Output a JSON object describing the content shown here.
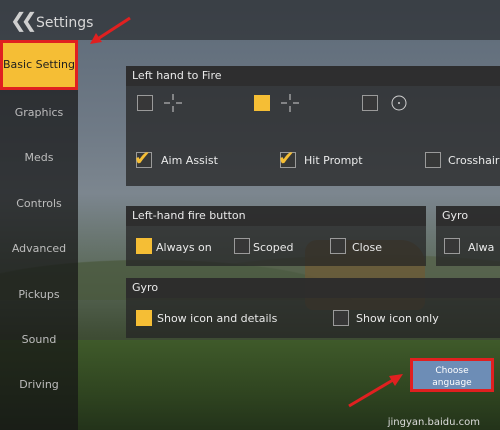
{
  "window": {
    "title": "Settings"
  },
  "sidebar": {
    "items": [
      {
        "label": "Basic Setting",
        "active": true
      },
      {
        "label": "Graphics"
      },
      {
        "label": "Meds"
      },
      {
        "label": "Controls"
      },
      {
        "label": "Advanced"
      },
      {
        "label": "Pickups"
      },
      {
        "label": "Sound"
      },
      {
        "label": "Driving"
      }
    ]
  },
  "left_hand_fire": {
    "title": "Left hand to Fire",
    "options": [
      {
        "checked": false,
        "icon": "crosshair-plus-icon"
      },
      {
        "checked": true,
        "icon": "crosshair-plus-icon"
      },
      {
        "checked": false,
        "icon": "crosshair-circle-icon"
      }
    ],
    "toggles": [
      {
        "label": "Aim Assist",
        "checked": true
      },
      {
        "label": "Hit Prompt",
        "checked": true
      },
      {
        "label": "Crosshair",
        "checked": false
      }
    ]
  },
  "left_hand_fire_button": {
    "title": "Left-hand fire button",
    "options": [
      {
        "label": "Always on",
        "checked": true
      },
      {
        "label": "Scoped",
        "checked": false
      },
      {
        "label": "Close",
        "checked": false
      }
    ]
  },
  "gyro_small": {
    "title": "Gyro",
    "options": [
      {
        "label": "Alwa",
        "checked": false
      }
    ]
  },
  "gyro": {
    "title": "Gyro",
    "options": [
      {
        "label": "Show icon and details",
        "checked": true
      },
      {
        "label": "Show icon only",
        "checked": false
      }
    ]
  },
  "choose_language": {
    "label_line1": "Choose",
    "label_line2": "anguage"
  },
  "watermark": "jingyan.baidu.com",
  "colors": {
    "accent": "#f5be35",
    "highlight": "#e02020",
    "button": "#6d8db6"
  }
}
